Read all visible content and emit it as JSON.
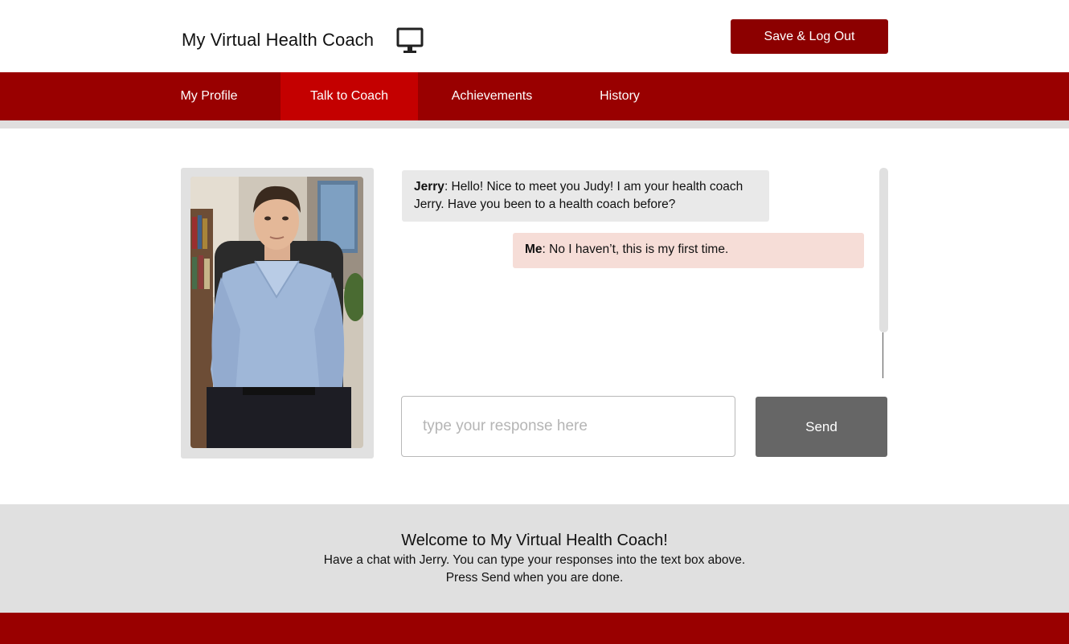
{
  "header": {
    "app_title": "My Virtual Health Coach",
    "logo_icon": "monitor-icon",
    "logout_label": "Save & Log Out"
  },
  "nav": {
    "items": [
      {
        "label": "My Profile",
        "active": false
      },
      {
        "label": "Talk to Coach",
        "active": true
      },
      {
        "label": "Achievements",
        "active": false
      },
      {
        "label": "History",
        "active": false
      }
    ]
  },
  "chat": {
    "messages": [
      {
        "speaker": "Jerry",
        "text": ": Hello! Nice to meet you Judy! I am your health coach Jerry. Have you been to a health coach before?"
      },
      {
        "speaker": "Me",
        "text": ": No I haven’t, this is my first time."
      }
    ],
    "input_value": "",
    "input_placeholder": "type your response here",
    "send_label": "Send"
  },
  "info": {
    "title": "Welcome to My Virtual Health Coach!",
    "line1": "Have a chat with Jerry. You can type your responses into the text box above.",
    "line2": "Press Send when you are done."
  },
  "colors": {
    "brand_red": "#990000",
    "active_tab": "#c40000",
    "logout_button": "#8c0000",
    "coach_bubble": "#e9e9e9",
    "user_bubble": "#f6ddd7",
    "send_button": "#666666"
  }
}
